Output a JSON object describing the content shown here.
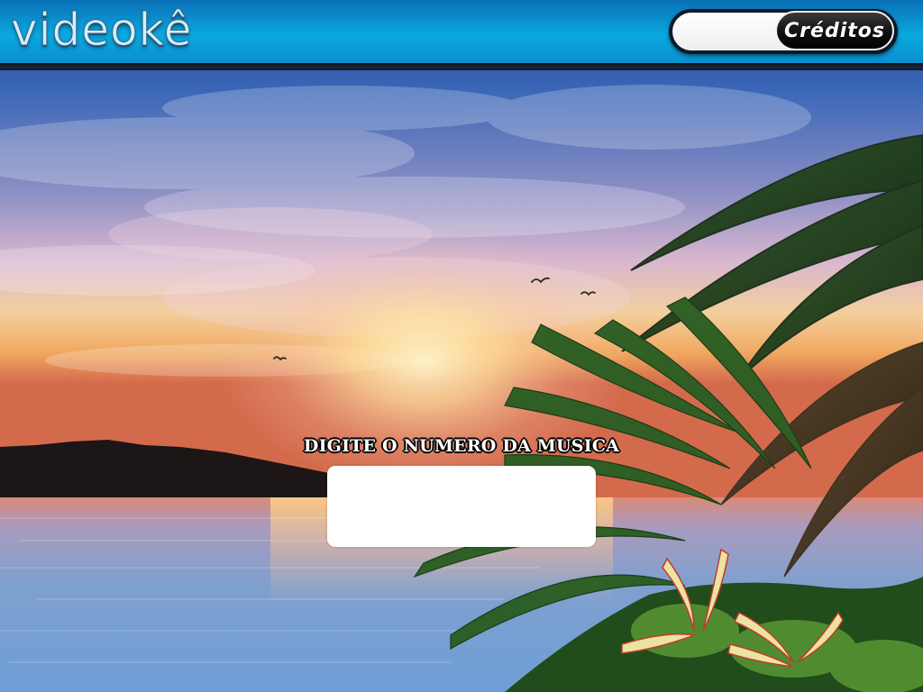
{
  "app": {
    "logo_text": "videokê"
  },
  "header": {
    "credits_value": "",
    "credits_button_label": "Créditos"
  },
  "main": {
    "prompt_label": "DIGITE O NUMERO DA MUSICA",
    "song_number_value": ""
  },
  "background": {
    "scene": "tropical-sunset-lake-palm-trees"
  },
  "colors": {
    "header_top": "#0a6fb5",
    "header_mid": "#0aa9e0",
    "header_accent": "#0a8fcf",
    "credits_button": "#111111",
    "input_bg": "#ffffff"
  }
}
